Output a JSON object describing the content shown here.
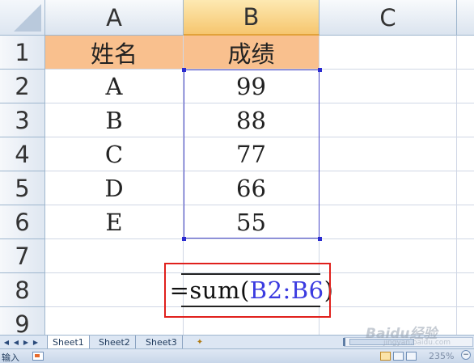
{
  "columns": [
    "A",
    "B",
    "C"
  ],
  "rows": [
    "1",
    "2",
    "3",
    "4",
    "5",
    "6",
    "7",
    "8",
    "9"
  ],
  "table": {
    "header": [
      "姓名",
      "成绩"
    ],
    "records": [
      [
        "A",
        "99"
      ],
      [
        "B",
        "88"
      ],
      [
        "C",
        "77"
      ],
      [
        "D",
        "66"
      ],
      [
        "E",
        "55"
      ]
    ]
  },
  "formula": {
    "prefix": "=sum(",
    "range": "B2:B6",
    "suffix": ")"
  },
  "sheet_tabs": [
    "Sheet1",
    "Sheet2",
    "Sheet3"
  ],
  "active_sheet": "Sheet1",
  "status": {
    "mode": "输入",
    "zoom": "235%"
  },
  "watermark": {
    "brand": "Baidu经验",
    "url": "jingyan.baidu.com"
  },
  "colors": {
    "header_fill": "#f9c08e",
    "range_border": "#4a4ac8",
    "highlight_box": "#e0201c",
    "formula_ref": "#3b3be0"
  }
}
